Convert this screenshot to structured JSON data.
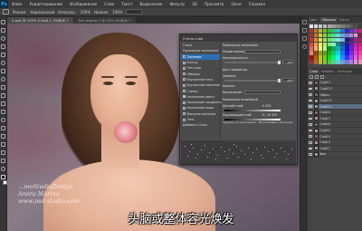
{
  "menubar": {
    "logo": "Ps",
    "items": [
      "Файл",
      "Редактирование",
      "Изображение",
      "Слои",
      "Текст",
      "Выделение",
      "Фильтр",
      "3D",
      "Просмотр",
      "Окно",
      "Справка"
    ]
  },
  "options_bar": {
    "mode_label": "Режим:",
    "mode_value": "Нормальный",
    "opacity_label": "Непрозр.:",
    "opacity_value": "100%",
    "flow_label": "Нажим:",
    "flow_value": "100%"
  },
  "document_tabs": [
    {
      "label": "2.psd @ 100% (Слой 2, RGB/8) *",
      "active": true
    },
    {
      "label": "Без имени-1 @ 50% (RGB/8) *",
      "active": false
    }
  ],
  "canvas": {
    "watermark_line1": "...moStudioDesign",
    "watermark_line2": "Anora Marina",
    "watermark_line3": "www.psd-studio.com"
  },
  "blending_dialog": {
    "title": "Стиль слоя",
    "list_items": [
      {
        "label": "Стили",
        "checked": false,
        "selected": false
      },
      {
        "label": "Параметры наложения",
        "checked": false,
        "selected": false
      },
      {
        "label": "Тиснение",
        "checked": false,
        "selected": true
      },
      {
        "label": "Контур",
        "checked": false,
        "selected": false
      },
      {
        "label": "Текстура",
        "checked": false,
        "selected": false
      },
      {
        "label": "Обводка",
        "checked": false,
        "selected": false
      },
      {
        "label": "Внутренняя тень",
        "checked": false,
        "selected": false
      },
      {
        "label": "Внутреннее свечение",
        "checked": false,
        "selected": false
      },
      {
        "label": "Глянец",
        "checked": false,
        "selected": false
      },
      {
        "label": "Наложение цвета",
        "checked": true,
        "selected": false
      },
      {
        "label": "Наложение градиента",
        "checked": false,
        "selected": false
      },
      {
        "label": "Наложение узора",
        "checked": false,
        "selected": false
      },
      {
        "label": "Внешнее свечение",
        "checked": false,
        "selected": false
      },
      {
        "label": "Тень",
        "checked": false,
        "selected": false
      },
      {
        "label": "Добавить стиль",
        "checked": false,
        "selected": false
      }
    ],
    "section_labels": [
      "Параметры наложения",
      "Режим наложения:",
      "Непрозрачность:",
      "Доп. параметры",
      "Заливка:",
      "Каналы:",
      "Исключение:",
      "Наложение если:"
    ],
    "opacity_value": "100",
    "fill_value": "100",
    "blend_if_left": "Серый",
    "this_layer_label": "Данный слой:",
    "this_layer_values": "0   255",
    "underlying_label": "Подлежащий слой:",
    "underlying_values": "0 / 15   255",
    "footer_left": "Сделать по умолчанию",
    "footer_right": "Восстановить значения"
  },
  "right_panel": {
    "tabs": [
      "Цвет",
      "Образцы",
      "Кисть"
    ],
    "layers_tabs": [
      "Слои",
      "Каналы",
      "Контуры"
    ],
    "layers": [
      {
        "name": "Слой 3",
        "active": false
      },
      {
        "name": "Слой 13",
        "active": false
      },
      {
        "name": "Обрез.",
        "active": false
      },
      {
        "name": "Слой 12",
        "active": false
      },
      {
        "name": "Слой 11",
        "active": true
      },
      {
        "name": "Слой 8",
        "active": false
      },
      {
        "name": "Слой 7",
        "active": false
      },
      {
        "name": "Слой 6",
        "active": false
      },
      {
        "name": "Слой 5",
        "active": false
      },
      {
        "name": "Слой 4",
        "active": false
      },
      {
        "name": "Слой 3",
        "active": false
      },
      {
        "name": "Слой 2",
        "active": false
      },
      {
        "name": "Фон",
        "active": false
      }
    ]
  },
  "subtitle": "头脑或整体容光焕发"
}
